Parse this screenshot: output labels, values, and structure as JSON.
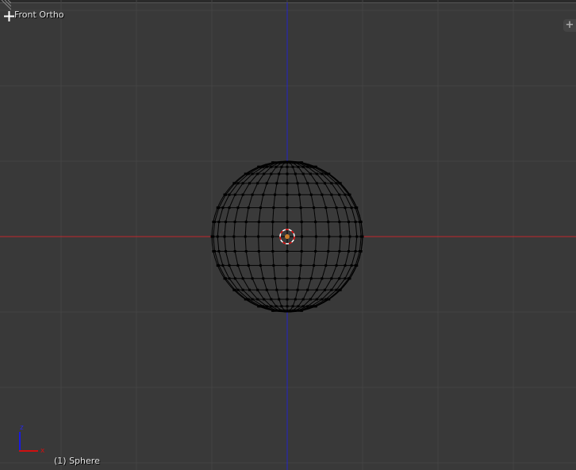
{
  "viewport": {
    "view_name": "Front Ortho",
    "object_label": "(1) Sphere",
    "add_button": "+"
  },
  "axes": {
    "z_label": "z",
    "x_label": "x"
  },
  "colors": {
    "background": "#393939",
    "grid": "#444444",
    "x_axis": "#c1272d",
    "z_axis": "#2424c8",
    "wire": "#000000"
  },
  "sphere": {
    "segments": 32,
    "rings": 16
  }
}
